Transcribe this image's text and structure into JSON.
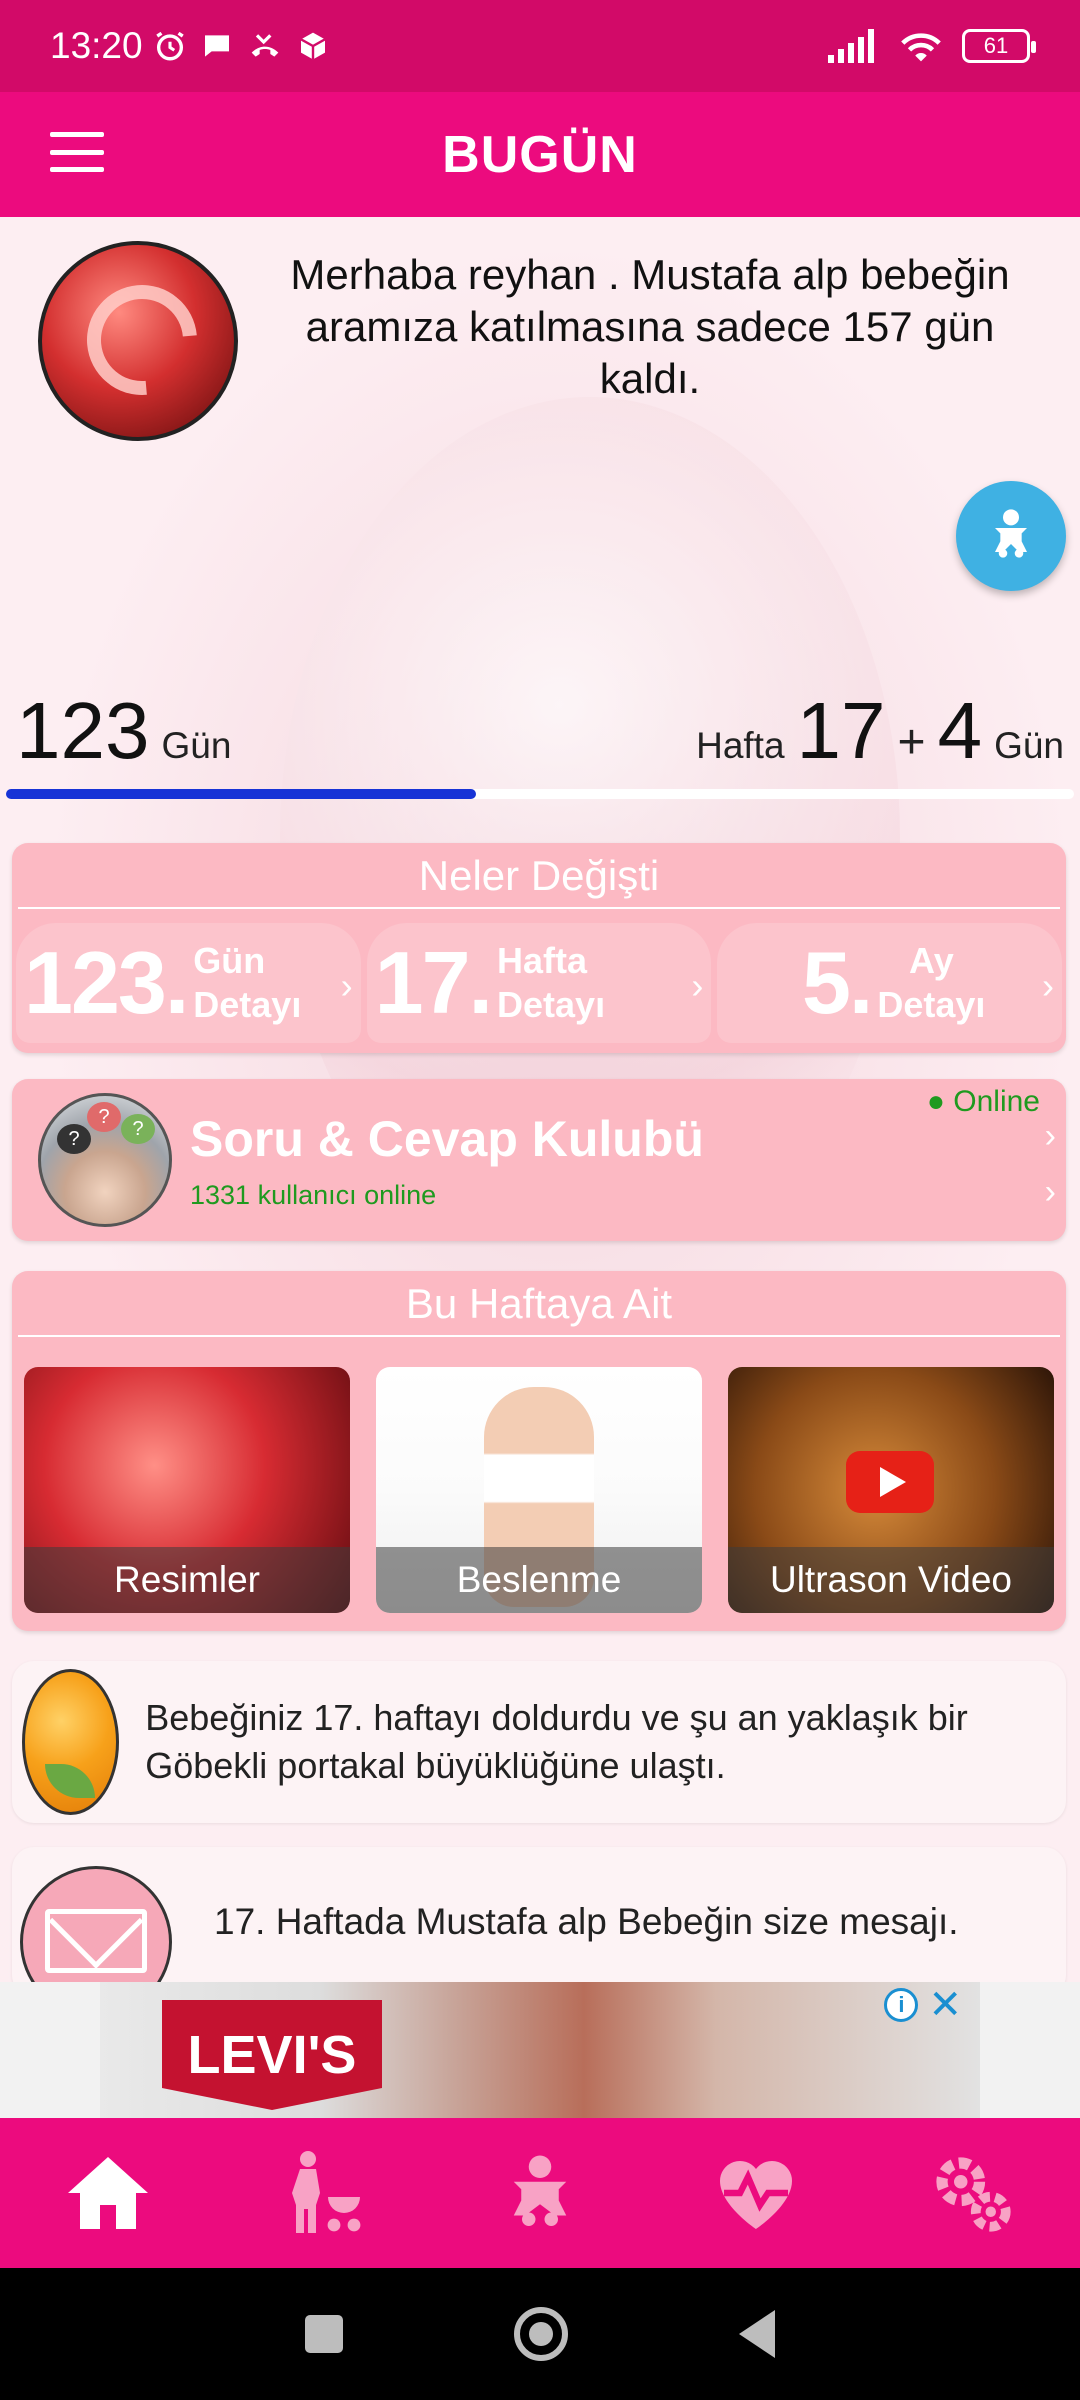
{
  "status_bar": {
    "time": "13:20",
    "battery": "61",
    "icons": [
      "alarm-icon",
      "chat-bubble-icon",
      "missed-call-icon",
      "package-icon",
      "signal-icon",
      "wifi-icon",
      "battery-icon"
    ]
  },
  "app_bar": {
    "title": "BUGÜN",
    "menu_icon": "hamburger-menu-icon"
  },
  "greeting": {
    "text": "Merhaba reyhan . Mustafa alp bebeğin aramıza katılmasına sadece 157 gün kaldı."
  },
  "counters": {
    "days_value": "123",
    "days_label": "Gün",
    "week_prefix": "Hafta",
    "week_value": "17",
    "plus": "+",
    "extra_days": "4",
    "extra_days_label": "Gün",
    "progress_fraction": 0.44
  },
  "changes_panel": {
    "title": "Neler Değişti",
    "items": [
      {
        "number": "123.",
        "line1": "Gün",
        "line2": "Detayı"
      },
      {
        "number": "17.",
        "line1": "Hafta",
        "line2": "Detayı"
      },
      {
        "number": "5.",
        "line1": "Ay",
        "line2": "Detayı"
      }
    ]
  },
  "qa_club": {
    "title": "Soru & Cevap Kulubü",
    "online_label": "● Online",
    "users_online": "1331 kullanıcı online",
    "bubbles": [
      "?",
      "?",
      "?"
    ]
  },
  "week_panel": {
    "title": "Bu Haftaya Ait",
    "tiles": [
      {
        "label": "Resimler"
      },
      {
        "label": "Beslenme"
      },
      {
        "label": "Ultrason Video"
      }
    ]
  },
  "fact_card": {
    "text": "Bebeğiniz 17. haftayı doldurdu ve şu an yaklaşık bir Göbekli portakal büyüklüğüne ulaştı."
  },
  "message_card": {
    "text": "17. Haftada Mustafa alp Bebeğin size mesajı."
  },
  "ad": {
    "brand": "LEVI'S",
    "info_icon": "i",
    "close_icon": "✕"
  },
  "bottom_nav": [
    "home-icon",
    "mother-stroller-icon",
    "baby-icon",
    "heart-rate-icon",
    "settings-gears-icon"
  ],
  "colors": {
    "status_bar": "#d20a68",
    "app_bar": "#ec0b7e",
    "panel": "#fcb9c3",
    "progress": "#1733d6",
    "online_green": "#1f9a1f",
    "fab": "#3fb1e3"
  }
}
